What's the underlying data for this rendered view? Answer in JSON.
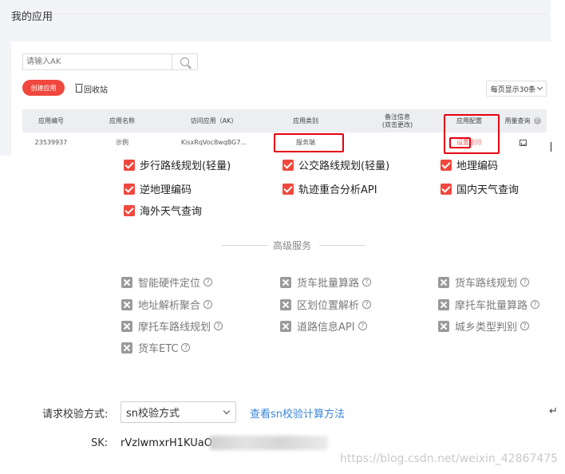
{
  "page": {
    "title": "我的应用"
  },
  "search": {
    "placeholder": "请输入AK"
  },
  "toolbar": {
    "create_label": "创建应用",
    "recycle_label": "回收站",
    "page_size_label": "每页显示30条"
  },
  "table": {
    "headers": {
      "app_id": "应用编号",
      "app_name": "应用名称",
      "ak": "访问应用（AK）",
      "category": "应用类别",
      "note_line1": "备注信息",
      "note_line2": "(双击更改)",
      "config": "应用配置",
      "usage": "用量查询"
    },
    "rows": [
      {
        "app_id": "23539937",
        "app_name": "示例",
        "ak": "KisxRqVoc8wqBG7...",
        "category": "服务端",
        "settings": "设置",
        "delete": "删除"
      }
    ]
  },
  "services": {
    "partial_row": [
      "步行路线规划(轻量)",
      "公交路线规划(轻量)",
      "地理编码"
    ],
    "enabled": [
      "逆地理编码",
      "轨迹重合分析API",
      "国内天气查询",
      "海外天气查询"
    ],
    "advanced_title": "高级服务",
    "advanced": [
      "智能硬件定位",
      "货车批量算路",
      "货车路线规划",
      "地址解析聚合",
      "区划位置解析",
      "摩托车批量算路",
      "摩托车路线规划",
      "道路信息API",
      "城乡类型判别",
      "货车ETC"
    ]
  },
  "verify": {
    "label": "请求校验方式:",
    "selected": "sn校验方式",
    "link": "查看sn校验计算方法",
    "sk_label": "SK:",
    "sk_value": "rVzlwmxrH1KUaO"
  },
  "watermark": "https://blog.csdn.net/weixin_42867475",
  "colors": {
    "accent_red": "#f0483e",
    "highlight_red": "#e60012",
    "link_blue": "#3a85d8"
  },
  "icons": [
    "search-icon",
    "trash-icon",
    "help-icon",
    "chart-icon",
    "checkbox-checked-icon",
    "checkbox-disabled-icon",
    "question-icon",
    "chevron-down-icon"
  ]
}
